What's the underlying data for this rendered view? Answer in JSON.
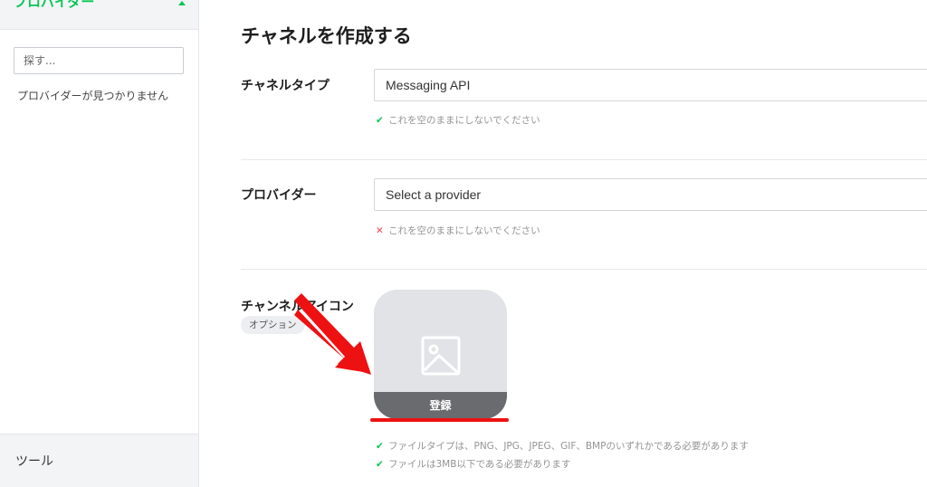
{
  "sidebar": {
    "section_title": "プロバイダー",
    "search_placeholder": "探す...",
    "empty_text": "プロバイダーが見つかりません",
    "tools_label": "ツール"
  },
  "main": {
    "title": "チャネルを作成する",
    "channel_type": {
      "label": "チャネルタイプ",
      "value": "Messaging API",
      "hint": "これを空のままにしないでください",
      "hint_status": "ok"
    },
    "provider": {
      "label": "プロバイダー",
      "placeholder": "Select a provider",
      "hint": "これを空のままにしないでください",
      "hint_status": "error"
    },
    "channel_icon": {
      "label": "チャンネルアイコン",
      "optional_badge": "オプション",
      "register_label": "登録",
      "hints": [
        "ファイルタイプは、PNG、JPG、JPEG、GIF、BMPのいずれかである必要があります",
        "ファイルは3MB以下である必要があります"
      ]
    }
  },
  "icons": {
    "check": "✔",
    "cross": "✕",
    "caret": "caret-up-icon",
    "image": "image-placeholder-icon",
    "arrow": "red-arrow-annotation"
  },
  "colors": {
    "brand_green": "#06c755",
    "error_red": "#ef454d",
    "annotation_red": "#ee1111"
  }
}
